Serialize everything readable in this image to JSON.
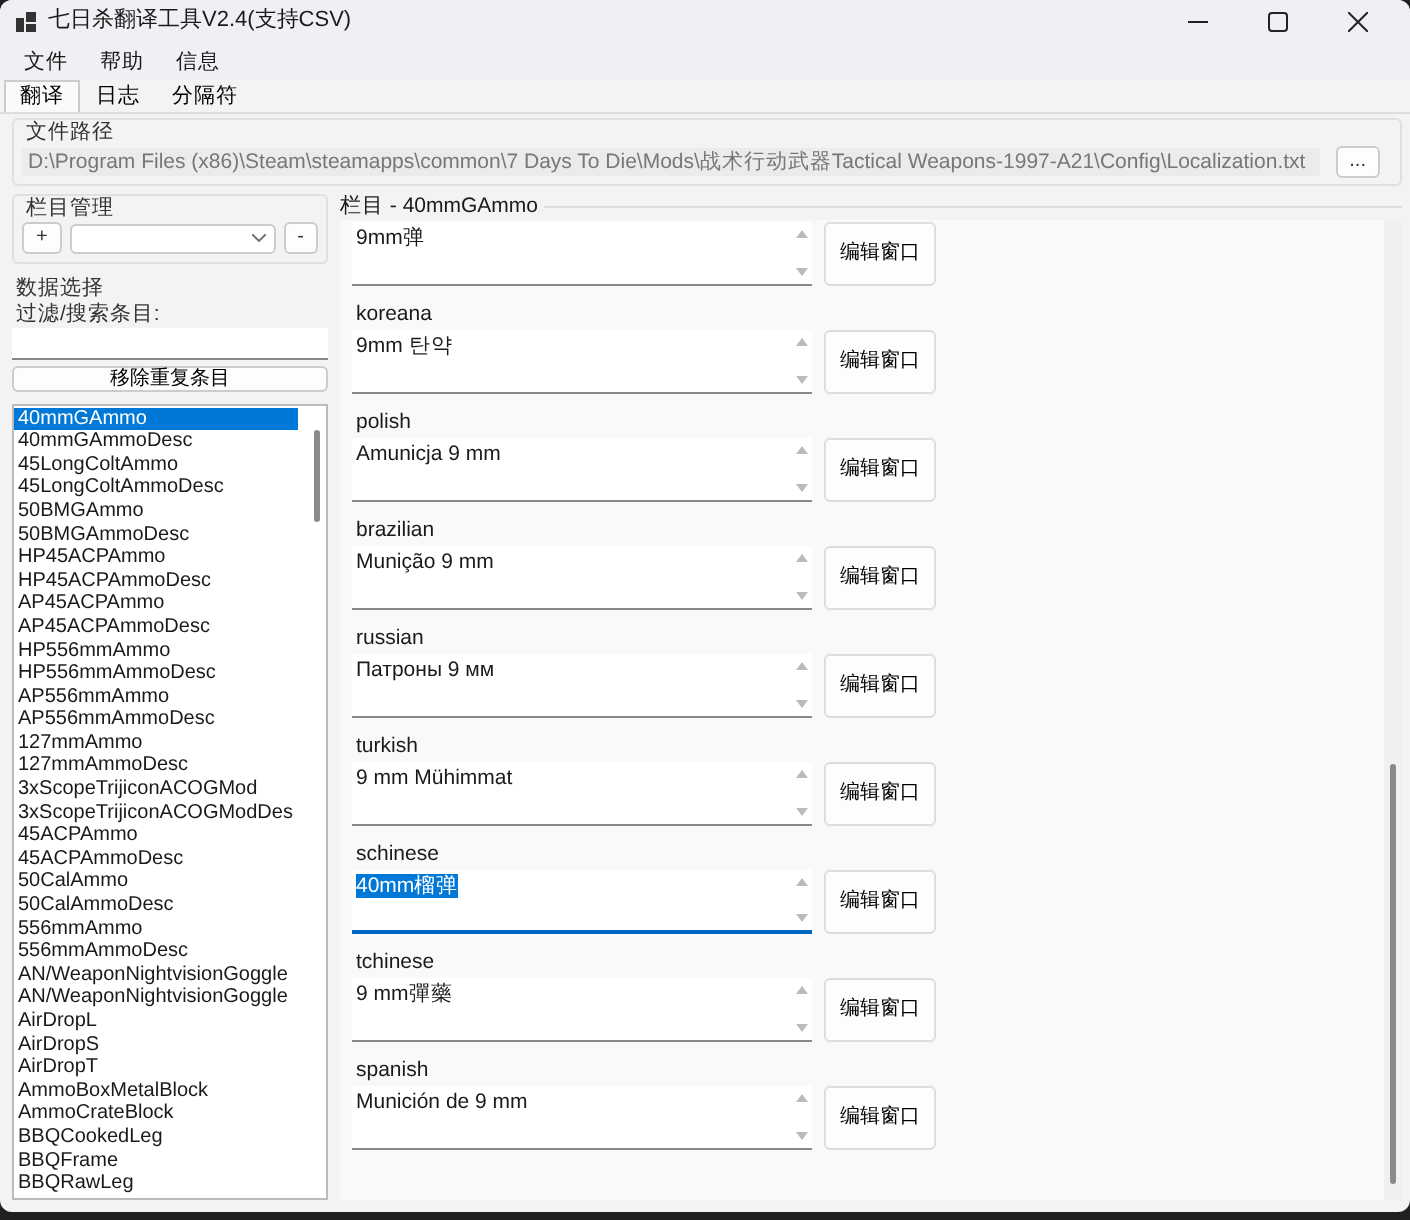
{
  "window": {
    "title": "七日杀翻译工具V2.4(支持CSV)"
  },
  "menu": [
    "文件",
    "帮助",
    "信息"
  ],
  "tabs": [
    {
      "label": "翻译",
      "selected": true
    },
    {
      "label": "日志",
      "selected": false
    },
    {
      "label": "分隔符",
      "selected": false
    }
  ],
  "file_path": {
    "label": "文件路径",
    "value": "D:\\Program Files (x86)\\Steam\\steamapps\\common\\7 Days To Die\\Mods\\战术行动武器Tactical Weapons-1997-A21\\Config\\Localization.txt",
    "browse_button": "..."
  },
  "column_manager": {
    "label": "栏目管理",
    "add_button": "+",
    "remove_button": "-"
  },
  "data_selection": {
    "label": "数据选择",
    "filter_label": "过滤/搜索条目:",
    "remove_duplicates_button": "移除重复条目",
    "items": [
      {
        "label": "40mmGAmmo",
        "selected": true
      },
      {
        "label": "40mmGAmmoDesc",
        "selected": false
      },
      {
        "label": "45LongColtAmmo",
        "selected": false
      },
      {
        "label": "45LongColtAmmoDesc",
        "selected": false
      },
      {
        "label": "50BMGAmmo",
        "selected": false
      },
      {
        "label": "50BMGAmmoDesc",
        "selected": false
      },
      {
        "label": "HP45ACPAmmo",
        "selected": false
      },
      {
        "label": "HP45ACPAmmoDesc",
        "selected": false
      },
      {
        "label": "AP45ACPAmmo",
        "selected": false
      },
      {
        "label": "AP45ACPAmmoDesc",
        "selected": false
      },
      {
        "label": "HP556mmAmmo",
        "selected": false
      },
      {
        "label": "HP556mmAmmoDesc",
        "selected": false
      },
      {
        "label": "AP556mmAmmo",
        "selected": false
      },
      {
        "label": "AP556mmAmmoDesc",
        "selected": false
      },
      {
        "label": "127mmAmmo",
        "selected": false
      },
      {
        "label": "127mmAmmoDesc",
        "selected": false
      },
      {
        "label": "3xScopeTrijiconACOGMod",
        "selected": false
      },
      {
        "label": "3xScopeTrijiconACOGModDes",
        "selected": false
      },
      {
        "label": "45ACPAmmo",
        "selected": false
      },
      {
        "label": "45ACPAmmoDesc",
        "selected": false
      },
      {
        "label": "50CalAmmo",
        "selected": false
      },
      {
        "label": "50CalAmmoDesc",
        "selected": false
      },
      {
        "label": "556mmAmmo",
        "selected": false
      },
      {
        "label": "556mmAmmoDesc",
        "selected": false
      },
      {
        "label": "AN/WeaponNightvisionGoggle",
        "selected": false
      },
      {
        "label": "AN/WeaponNightvisionGoggle",
        "selected": false
      },
      {
        "label": "AirDropL",
        "selected": false
      },
      {
        "label": "AirDropS",
        "selected": false
      },
      {
        "label": "AirDropT",
        "selected": false
      },
      {
        "label": "AmmoBoxMetalBlock",
        "selected": false
      },
      {
        "label": "AmmoCrateBlock",
        "selected": false
      },
      {
        "label": "BBQCookedLeg",
        "selected": false
      },
      {
        "label": "BBQFrame",
        "selected": false
      },
      {
        "label": "BBQRawLeg",
        "selected": false
      }
    ]
  },
  "column_panel": {
    "title": "栏目 - 40mmGAmmo",
    "entries": [
      {
        "value": "9mm弹",
        "focused": false,
        "button": "编辑窗口"
      },
      {
        "language": "koreana",
        "value": "9mm 탄약",
        "focused": false,
        "button": "编辑窗口"
      },
      {
        "language": "polish",
        "value": "Amunicja 9 mm",
        "focused": false,
        "button": "编辑窗口"
      },
      {
        "language": "brazilian",
        "value": "Munição 9 mm",
        "focused": false,
        "button": "编辑窗口"
      },
      {
        "language": "russian",
        "value": "Патроны 9 мм",
        "focused": false,
        "button": "编辑窗口"
      },
      {
        "language": "turkish",
        "value": "9 mm Mühimmat",
        "focused": false,
        "button": "编辑窗口"
      },
      {
        "language": "schinese",
        "value": "40mm榴弹",
        "focused": true,
        "button": "编辑窗口"
      },
      {
        "language": "tchinese",
        "value": "9 mm彈藥",
        "focused": false,
        "button": "编辑窗口"
      },
      {
        "language": "spanish",
        "value": "Munición de 9 mm",
        "focused": false,
        "button": "编辑窗口"
      }
    ]
  }
}
